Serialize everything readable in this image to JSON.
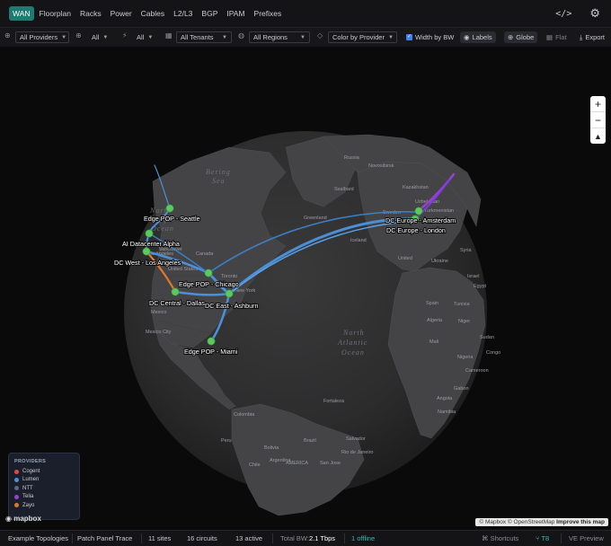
{
  "nav": {
    "tabs": [
      {
        "label": "WAN",
        "active": true
      },
      {
        "label": "Floorplan"
      },
      {
        "label": "Racks"
      },
      {
        "label": "Power"
      },
      {
        "label": "Cables"
      },
      {
        "label": "L2/L3"
      },
      {
        "label": "BGP"
      },
      {
        "label": "IPAM"
      },
      {
        "label": "Prefixes"
      }
    ],
    "code_icon": "</>",
    "settings_icon": "⚙"
  },
  "filters": {
    "providers": "All Providers",
    "type": "All",
    "status": "All",
    "tenants": "All Tenants",
    "regions": "All Regions",
    "color": "Color by Provider",
    "width_by_bw": "Width by BW",
    "labels": "Labels",
    "globe": "Globe",
    "flat": "Flat",
    "export": "Export"
  },
  "map": {
    "oceans": [
      {
        "text": "North",
        "id": "np1"
      },
      {
        "text": "Pacific",
        "id": "np2"
      },
      {
        "text": "Ocean",
        "id": "np3"
      },
      {
        "text": "North",
        "id": "na1"
      },
      {
        "text": "Atlantic",
        "id": "na2"
      },
      {
        "text": "Ocean",
        "id": "na3"
      },
      {
        "text": "Bering",
        "id": "b1"
      },
      {
        "text": "Sea",
        "id": "b2"
      }
    ],
    "places": {
      "russia": "Russia",
      "novosibirsk": "Novosibirsk",
      "svalbard": "Svalbard",
      "kazakhstan": "Kazakhstan",
      "uzbekistan": "Uzbekistan",
      "turkmenistan": "Turkmenistan",
      "greenland": "Greenland",
      "sweden": "Sweden",
      "iceland": "Iceland",
      "united": "United",
      "ukraine": "Ukraine",
      "syria": "Syria",
      "israel": "Israel",
      "egypt": "Egypt",
      "spain": "Spain",
      "tunisia": "Tunisia",
      "algeria": "Algeria",
      "niger": "Niger",
      "sudan": "Sudan",
      "mali": "Mali",
      "nigeria": "Nigeria",
      "congo": "Congo",
      "cameroon": "Cameroon",
      "gabon": "Gabon",
      "angola": "Angola",
      "namibia": "Namibia",
      "canada": "Canada",
      "vancouver": "Vancouver",
      "toronto": "Toronto",
      "newyork": "New York",
      "losangeles": "Los Angeles",
      "unitedstates": "United States",
      "mexico": "Mexico",
      "mexicocity": "Mexico City",
      "colombia": "Colombia",
      "peru": "Peru",
      "brazil": "Brazil",
      "bolivia": "Bolivia",
      "chile": "Chile",
      "argentina": "Argentina",
      "sanjose": "San Jose",
      "rio": "Rio de Janeiro",
      "salvador": "Salvador",
      "fortaleza": "Fortaleza",
      "southamerica": "AMERICA"
    },
    "sites": {
      "seattle": "Edge POP - Seattle",
      "alpha": "AI Datacenter Alpha",
      "la": "DC West - Los Angeles",
      "chicago": "Edge POP - Chicago",
      "dallas": "DC Central - Dallas",
      "ashburn": "DC East - Ashburn",
      "miami": "Edge POP - Miami",
      "amsterdam": "DC Europe - Amsterdam",
      "london": "DC Europe - London"
    },
    "zoom_in": "+",
    "zoom_out": "−",
    "compass": "▲"
  },
  "legend": {
    "title": "PROVIDERS",
    "items": [
      {
        "label": "Cogent",
        "color": "#e04848"
      },
      {
        "label": "Lumen",
        "color": "#4a90d9"
      },
      {
        "label": "NTT",
        "color": "#5a6a86"
      },
      {
        "label": "Telia",
        "color": "#9b3fd0"
      },
      {
        "label": "Zayo",
        "color": "#e0782a"
      }
    ]
  },
  "mapbox_logo": "mapbox",
  "attribution": {
    "text": "© Mapbox © OpenStreetMap",
    "link": "Improve this map"
  },
  "status": {
    "topologies": "Example Topologies",
    "patch": "Patch Panel Trace",
    "sites": "11 sites",
    "circuits": "16 circuits",
    "active": "13 active",
    "bw_label": "Total BW:",
    "bw_value": "2.1 Tbps",
    "offline": "1 offline",
    "shortcuts": "Shortcuts",
    "t8": "T8",
    "preview": "VE Preview"
  },
  "colors": {
    "accent": "#1f7a72",
    "site_marker": "#5cc95c",
    "lumen": "#4a90d9",
    "telia": "#9b3fd0",
    "zayo": "#e0782a"
  }
}
